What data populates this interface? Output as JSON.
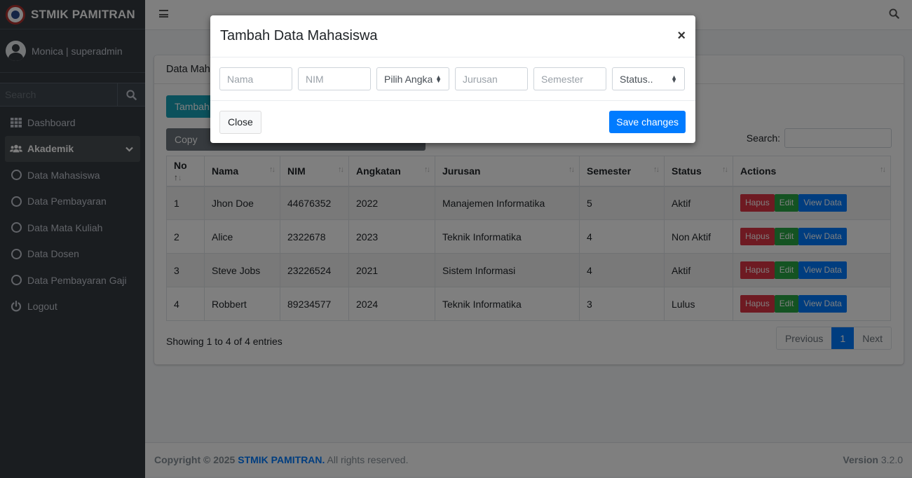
{
  "brand": {
    "name": "STMIK PAMITRAN"
  },
  "user": {
    "name": "Monica | superadmin"
  },
  "sidebar_search": {
    "placeholder": "Search"
  },
  "nav": {
    "dashboard": "Dashboard",
    "akademik": "Akademik",
    "mahasiswa": "Data Mahasiswa",
    "pembayaran": "Data Pembayaran",
    "matakuliah": "Data Mata Kuliah",
    "dosen": "Data Dosen",
    "gaji": "Data Pembayaran Gaji",
    "logout": "Logout"
  },
  "card": {
    "title": "Data Mahasiswa",
    "add_button": "Tambah Data",
    "copy_button": "Copy",
    "search_label": "Search:"
  },
  "table": {
    "headers": [
      "No",
      "Nama",
      "NIM",
      "Angkatan",
      "Jurusan",
      "Semester",
      "Status",
      "Actions"
    ],
    "rows": [
      [
        "1",
        "Jhon Doe",
        "44676352",
        "2022",
        "Manajemen Informatika",
        "5",
        "Aktif"
      ],
      [
        "2",
        "Alice",
        "2322678",
        "2023",
        "Teknik Informatika",
        "4",
        "Non Aktif"
      ],
      [
        "3",
        "Steve Jobs",
        "23226524",
        "2021",
        "Sistem Informasi",
        "4",
        "Aktif"
      ],
      [
        "4",
        "Robbert",
        "89234577",
        "2024",
        "Teknik Informatika",
        "3",
        "Lulus"
      ]
    ],
    "actions": {
      "delete": "Hapus",
      "edit": "Edit",
      "view": "View Data"
    }
  },
  "pagination": {
    "info": "Showing 1 to 4 of 4 entries",
    "previous": "Previous",
    "current": "1",
    "next": "Next"
  },
  "footer": {
    "copyright": "Copyright © 2025",
    "brand": "STMIK PAMITRAN.",
    "rights": "All rights reserved.",
    "version_label": "Version",
    "version": "3.2.0"
  },
  "modal": {
    "title": "Tambah Data Mahasiswa",
    "close_x": "×",
    "nama_placeholder": "Nama",
    "nim_placeholder": "NIM",
    "angkatan_select": "Pilih Angkatan",
    "jurusan_placeholder": "Jurusan",
    "semester_placeholder": "Semester",
    "status_select": "Status..",
    "close_button": "Close",
    "save_button": "Save changes"
  }
}
